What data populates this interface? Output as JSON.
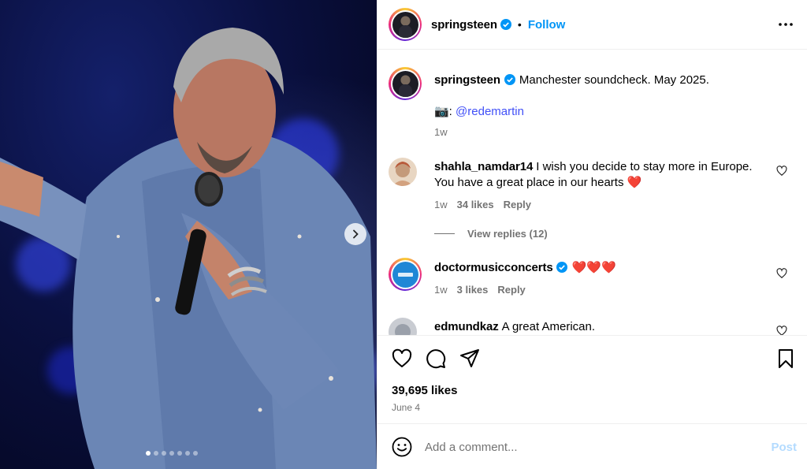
{
  "post": {
    "username": "springsteen",
    "follow_label": "Follow",
    "bullet": "•",
    "caption_user": "springsteen",
    "caption_text": "Manchester soundcheck. May 2025.",
    "caption_camera": "📷:",
    "caption_mention": "@redemartin",
    "caption_age": "1w"
  },
  "carousel": {
    "slide_count": 7,
    "active_index": 0
  },
  "comments": [
    {
      "username": "shahla_namdar14",
      "text": "I wish you decide to stay more in Europe. You have a great place in our hearts",
      "emoji": "❤️",
      "age": "1w",
      "likes": "34 likes",
      "reply": "Reply",
      "view_replies": "View replies (12)"
    },
    {
      "username": "doctormusicconcerts",
      "text": "❤️❤️❤️",
      "age": "1w",
      "likes": "3 likes",
      "reply": "Reply"
    },
    {
      "username": "edmundkaz",
      "text": "A great American."
    }
  ],
  "engagement": {
    "likes": "39,695 likes",
    "date": "June 4"
  },
  "composer": {
    "placeholder": "Add a comment...",
    "post_label": "Post"
  },
  "colors": {
    "link_blue": "#0095f6",
    "mention_blue": "#4150f7",
    "verified_blue": "#0095f6",
    "heart_red": "#ff3040",
    "post_disabled": "#b3dbff",
    "secondary_text": "#737373"
  }
}
